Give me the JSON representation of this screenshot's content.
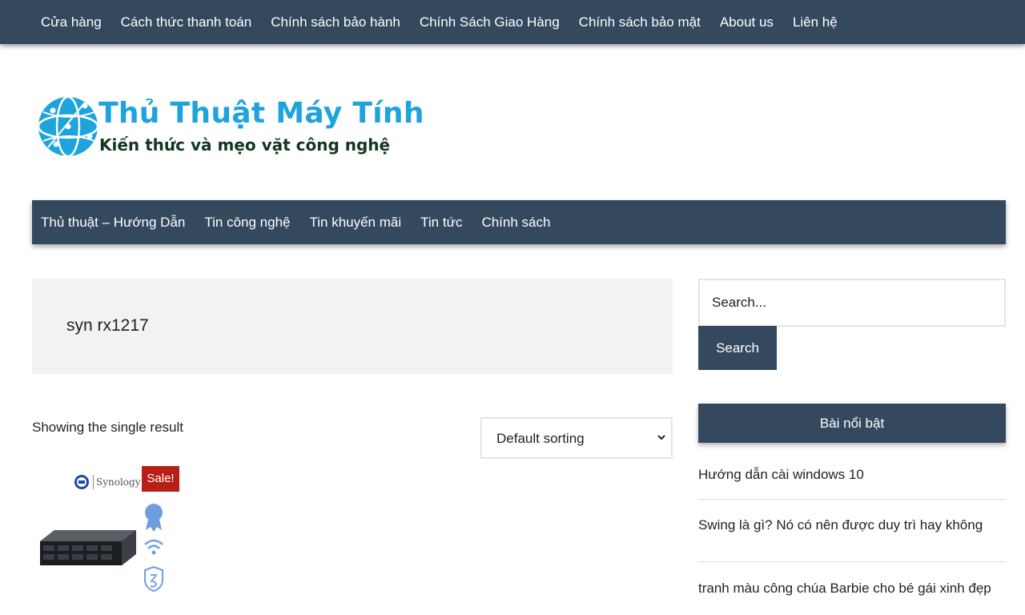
{
  "top_menu": [
    "Cửa hàng",
    "Cách thức thanh toán",
    "Chính sách bảo hành",
    "Chính Sách Giao Hàng",
    "Chính sách bảo mật",
    "About us",
    "Liên hệ"
  ],
  "logo": {
    "title": "Thủ Thuật Máy Tính",
    "tagline": "Kiến thức và mẹo vặt công nghệ",
    "colors": {
      "title": "#1fa3dc",
      "tagline": "#14361f"
    }
  },
  "main_menu": [
    "Thủ thuật – Hướng Dẫn",
    "Tin công nghệ",
    "Tin khuyến mãi",
    "Tin tức",
    "Chính sách"
  ],
  "search_heading": "syn rx1217",
  "result_count": "Showing the single result",
  "sorting": {
    "selected": "Default sorting"
  },
  "product": {
    "brand": "Synology",
    "sale_badge": "Sale!"
  },
  "sidebar": {
    "search_placeholder": "Search...",
    "search_button": "Search",
    "featured_title": "Bài nổi bật",
    "featured_posts": [
      "Hướng dẫn cài windows 10",
      "Swing là gì? Nó có nên được duy trì hay không",
      "tranh màu công chúa Barbie cho bé gái xinh đẹp"
    ]
  },
  "colors": {
    "nav_bg": "#34495e",
    "sale_bg": "#b81f17",
    "heading_box_bg": "#f2f2f2"
  }
}
